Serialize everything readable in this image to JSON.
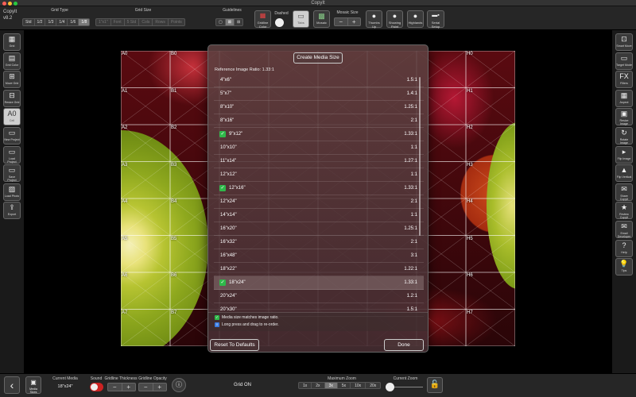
{
  "window": {
    "title": "CopyIt"
  },
  "app": {
    "name": "CopyIt",
    "version": "v8.2"
  },
  "colors": {
    "checkmark": "#2fb84a",
    "info_check": "#3a7be0",
    "panel_bg": "#262626"
  },
  "toolbar": {
    "grid_type_label": "Grid Type",
    "grid_types": [
      "Std",
      "1/2",
      "1/3",
      "1/4",
      "1/6",
      "1/8"
    ],
    "grid_type_selected": "1/8",
    "grid_size_label": "Grid Size",
    "grid_sizes": [
      "1\"x1\"",
      "Font",
      "5 Std",
      "Cols",
      "Rows",
      "Points"
    ],
    "guidelines_label": "Guidelines",
    "guideline_icons": [
      "guideline-none-icon",
      "guideline-diag-icon",
      "guideline-cross-icon"
    ],
    "gridline_color_label": "Gridline Color",
    "dashed_label": "Dashed",
    "tabs_label": "Tabs",
    "mosaic_label": "Mosaic",
    "mosaic_size_label": "Mosaic Size",
    "tools": [
      "Thumbs Up",
      "Showing Paint",
      "Highlands"
    ],
    "serial_label": "Serial Setup"
  },
  "left_sidebar": [
    {
      "label": "Grid",
      "icon": "grid-icon"
    },
    {
      "label": "Grid Color",
      "icon": "palette-icon"
    },
    {
      "label": "Move Grid",
      "icon": "move-grid-icon"
    },
    {
      "label": "Resize Grid",
      "icon": "resize-grid-icon"
    },
    {
      "label": "Cell",
      "icon": "cell-label-icon",
      "glyph": "A0"
    },
    {
      "label": "New Project",
      "icon": "new-folder-icon"
    },
    {
      "label": "Load Project",
      "icon": "open-folder-icon"
    },
    {
      "label": "Save Project",
      "icon": "save-folder-icon"
    },
    {
      "label": "Load Photo",
      "icon": "photo-icon"
    },
    {
      "label": "Export",
      "icon": "export-icon"
    }
  ],
  "right_sidebar": [
    {
      "label": "Smart Move",
      "icon": "smart-move-icon"
    },
    {
      "label": "Target Mode",
      "icon": "target-icon"
    },
    {
      "label": "Filters",
      "icon": "fx-icon",
      "glyph": "FX"
    },
    {
      "label": "Aspect",
      "icon": "aspect-icon"
    },
    {
      "label": "Resize Image",
      "icon": "resize-image-icon"
    },
    {
      "label": "Rotate Image",
      "icon": "rotate-icon"
    },
    {
      "label": "Flip Image",
      "icon": "flip-icon"
    },
    {
      "label": "Flip Vertical",
      "icon": "flip-vertical-icon"
    },
    {
      "label": "Share CopyIt",
      "icon": "share-icon"
    },
    {
      "label": "Review CopyIt",
      "icon": "review-icon"
    },
    {
      "label": "Email Developer",
      "icon": "email-icon"
    },
    {
      "label": "Help",
      "icon": "help-icon"
    },
    {
      "label": "Tips",
      "icon": "lightbulb-icon"
    }
  ],
  "grid": {
    "labels_left": [
      "A0",
      "A1",
      "A2",
      "A3",
      "A4",
      "A5",
      "A6",
      "A7"
    ],
    "labels_b": [
      "B0",
      "B1",
      "B2",
      "B3",
      "B4",
      "B5",
      "B6",
      "B7"
    ],
    "labels_right": [
      "H0",
      "H1",
      "H2",
      "H3",
      "H4",
      "H5",
      "H6",
      "H7"
    ]
  },
  "modal": {
    "title": "Create Media Size",
    "ratio_text": "Reference Image Ratio: 1.33:1",
    "sizes": [
      {
        "name": "4\"x6\"",
        "ratio": "1.5:1",
        "checked": false,
        "selected": false
      },
      {
        "name": "5\"x7\"",
        "ratio": "1.4:1",
        "checked": false,
        "selected": false
      },
      {
        "name": "8\"x10\"",
        "ratio": "1.25:1",
        "checked": false,
        "selected": false
      },
      {
        "name": "8\"x16\"",
        "ratio": "2:1",
        "checked": false,
        "selected": false
      },
      {
        "name": "9\"x12\"",
        "ratio": "1.33:1",
        "checked": true,
        "selected": false
      },
      {
        "name": "10\"x10\"",
        "ratio": "1:1",
        "checked": false,
        "selected": false
      },
      {
        "name": "11\"x14\"",
        "ratio": "1.27:1",
        "checked": false,
        "selected": false
      },
      {
        "name": "12\"x12\"",
        "ratio": "1:1",
        "checked": false,
        "selected": false
      },
      {
        "name": "12\"x16\"",
        "ratio": "1.33:1",
        "checked": true,
        "selected": false
      },
      {
        "name": "12\"x24\"",
        "ratio": "2:1",
        "checked": false,
        "selected": false
      },
      {
        "name": "14\"x14\"",
        "ratio": "1:1",
        "checked": false,
        "selected": false
      },
      {
        "name": "16\"x20\"",
        "ratio": "1.25:1",
        "checked": false,
        "selected": false
      },
      {
        "name": "16\"x32\"",
        "ratio": "2:1",
        "checked": false,
        "selected": false
      },
      {
        "name": "16\"x48\"",
        "ratio": "3:1",
        "checked": false,
        "selected": false
      },
      {
        "name": "18\"x22\"",
        "ratio": "1.22:1",
        "checked": false,
        "selected": false
      },
      {
        "name": "18\"x24\"",
        "ratio": "1.33:1",
        "checked": true,
        "selected": true
      },
      {
        "name": "20\"x24\"",
        "ratio": "1.2:1",
        "checked": false,
        "selected": false
      },
      {
        "name": "20\"x30\"",
        "ratio": "1.5:1",
        "checked": false,
        "selected": false
      }
    ],
    "legend_match": "Media size matches image ratio.",
    "legend_reorder": "Long press and drag to re-order.",
    "reset_label": "Reset To Defaults",
    "done_label": "Done"
  },
  "bottombar": {
    "media_sizes_label": "Media Sizes",
    "current_media_label": "Current Media",
    "current_media_value": "18\"x24\"",
    "sound_label": "Sound",
    "gridline_thickness_label": "Gridline Thickness",
    "gridline_opacity_label": "Gridline Opacity",
    "grid_status": "Grid ON",
    "max_zoom_label": "Maximum Zoom",
    "zoom_options": [
      "1x",
      "2x",
      "3x",
      "5x",
      "10x",
      "20x"
    ],
    "zoom_selected": "3x",
    "current_zoom_label": "Current Zoom"
  }
}
